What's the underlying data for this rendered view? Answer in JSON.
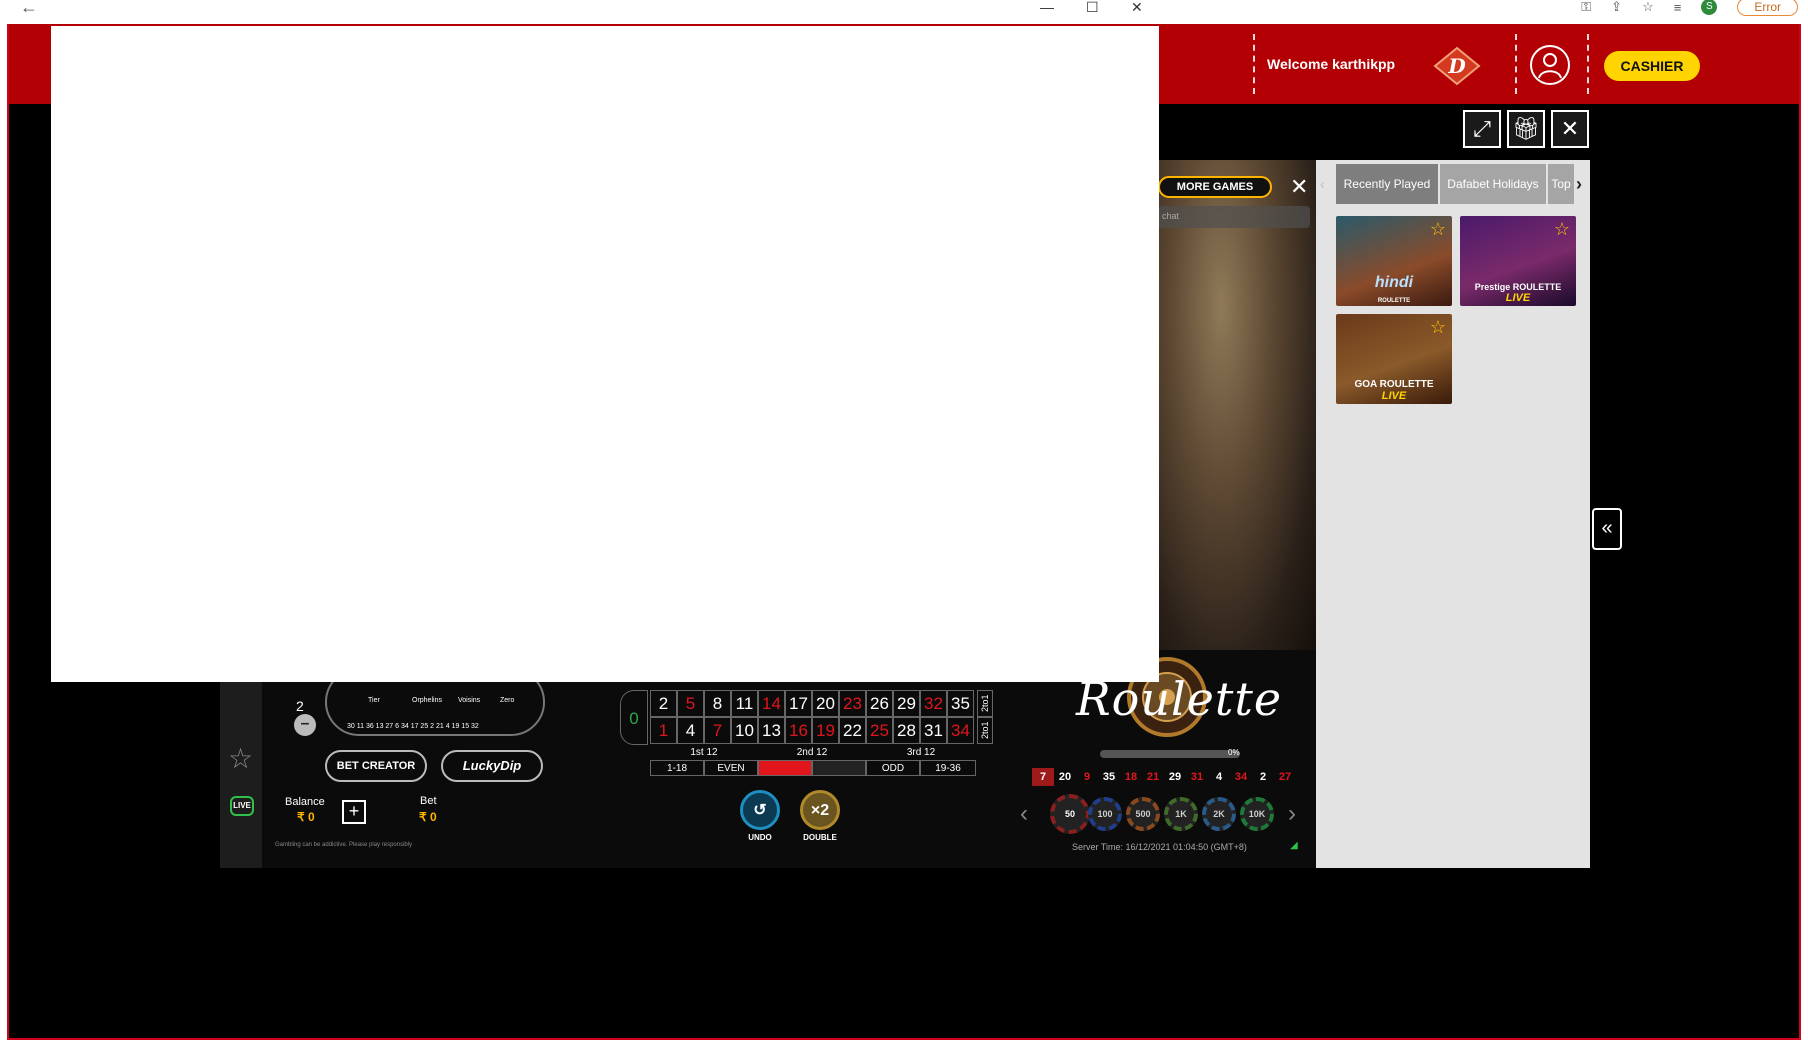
{
  "browser": {
    "back_glyph": "←",
    "minimize_glyph": "—",
    "maximize_glyph": "☐",
    "close_glyph": "✕",
    "profile_initial": "S",
    "error_label": "Error"
  },
  "header": {
    "welcome_text": "Welcome karthikpp",
    "cashier_label": "CASHIER"
  },
  "game": {
    "more_games_label": "MORE GAMES",
    "chat_placeholder": "chat",
    "logo_text": "Roulette",
    "progress_label": "0%",
    "progress_fraction": 0,
    "recent_numbers": [
      {
        "value": "7",
        "color": "red-box"
      },
      {
        "value": "20",
        "color": "white"
      },
      {
        "value": "9",
        "color": "red"
      },
      {
        "value": "35",
        "color": "white"
      },
      {
        "value": "18",
        "color": "red"
      },
      {
        "value": "21",
        "color": "red"
      },
      {
        "value": "29",
        "color": "white"
      },
      {
        "value": "31",
        "color": "red"
      },
      {
        "value": "4",
        "color": "white"
      },
      {
        "value": "34",
        "color": "red"
      },
      {
        "value": "2",
        "color": "white"
      },
      {
        "value": "27",
        "color": "red"
      }
    ],
    "chips": [
      "50",
      "100",
      "500",
      "1K",
      "2K",
      "10K"
    ],
    "server_time": "Server Time: 16/12/2021 01:04:50 (GMT+8)",
    "board": {
      "zero": "0",
      "row_top": [
        {
          "n": "2",
          "red": false
        },
        {
          "n": "5",
          "red": true
        },
        {
          "n": "8",
          "red": false
        },
        {
          "n": "11",
          "red": false
        },
        {
          "n": "14",
          "red": true
        },
        {
          "n": "17",
          "red": false
        },
        {
          "n": "20",
          "red": false
        },
        {
          "n": "23",
          "red": true
        },
        {
          "n": "26",
          "red": false
        },
        {
          "n": "29",
          "red": false
        },
        {
          "n": "32",
          "red": true
        },
        {
          "n": "35",
          "red": false
        }
      ],
      "row_bottom": [
        {
          "n": "1",
          "red": true
        },
        {
          "n": "4",
          "red": false
        },
        {
          "n": "7",
          "red": true
        },
        {
          "n": "10",
          "red": false
        },
        {
          "n": "13",
          "red": false
        },
        {
          "n": "16",
          "red": true
        },
        {
          "n": "19",
          "red": true
        },
        {
          "n": "22",
          "red": false
        },
        {
          "n": "25",
          "red": true
        },
        {
          "n": "28",
          "red": false
        },
        {
          "n": "31",
          "red": false
        },
        {
          "n": "34",
          "red": true
        }
      ],
      "col_label": "2to1",
      "dozens": [
        "1st 12",
        "2nd 12",
        "3rd 12"
      ],
      "outside": [
        "1-18",
        "EVEN",
        "",
        "",
        "ODD",
        "19-36"
      ]
    },
    "undo_label": "UNDO",
    "double_label": "DOUBLE",
    "double_glyph": "×2",
    "racetrack": {
      "sections": [
        "Tier",
        "Orphelins",
        "Voisins",
        "Zero"
      ],
      "count": "2",
      "numbers": "30 11 36 13 27 6 34 17 25 2 21 4 19 15 32"
    },
    "bet_creator_label": "BET CREATOR",
    "lucky_dip_label": "LuckyDip",
    "balance_label": "Balance",
    "balance_value": "₹ 0",
    "bet_label": "Bet",
    "bet_value": "₹ 0",
    "live_badge": "LIVE",
    "disclaimer": "Gambling can be addictive. Please play responsibly"
  },
  "right_panel": {
    "tabs": [
      "Recently Played",
      "Dafabet Holidays",
      "Top"
    ],
    "games": [
      {
        "title": "hindi",
        "subtitle": "ROULETTE",
        "live": ""
      },
      {
        "title": "Prestige ROULETTE",
        "subtitle": "",
        "live": "LIVE"
      },
      {
        "title": "GOA ROULETTE",
        "subtitle": "",
        "live": "LIVE"
      }
    ]
  },
  "colors": {
    "brand_red": "#b30005",
    "cashier_yellow": "#ffd400",
    "accent_gold": "#ffb400"
  }
}
